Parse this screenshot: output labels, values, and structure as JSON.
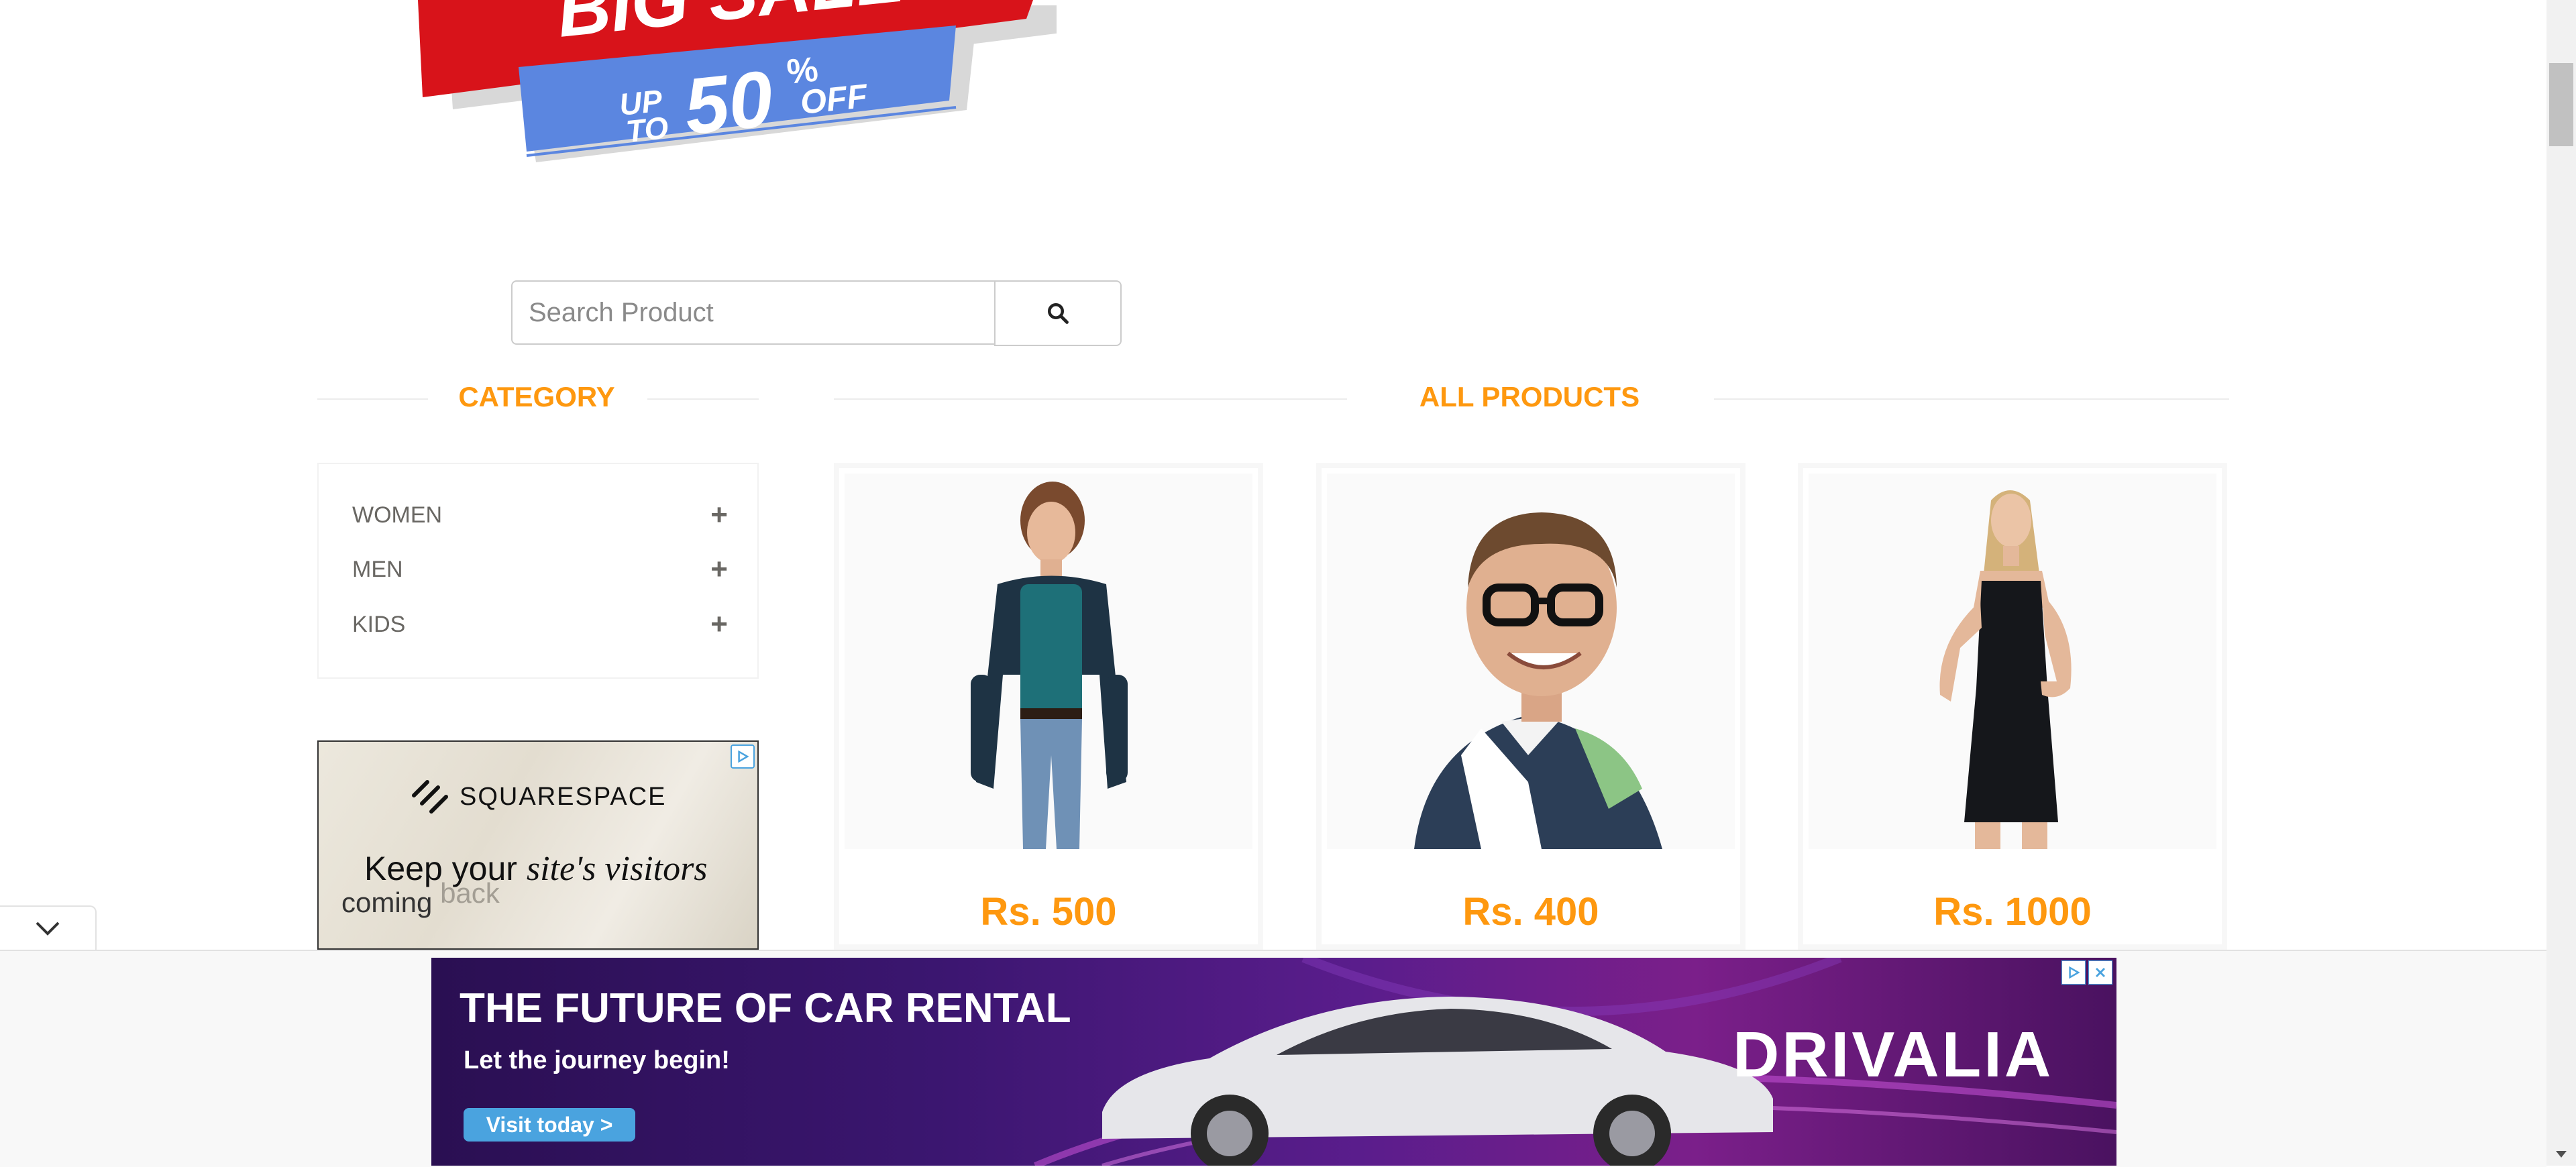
{
  "logo": {
    "line1": "BIG SALE",
    "up": "UP",
    "to": "TO",
    "percent": "50",
    "pct_sign": "%",
    "off": "OFF"
  },
  "search": {
    "placeholder": "Search Product",
    "value": ""
  },
  "category": {
    "heading": "CATEGORY",
    "items": [
      {
        "label": "WOMEN",
        "expand": "+"
      },
      {
        "label": "MEN",
        "expand": "+"
      },
      {
        "label": "KIDS",
        "expand": "+"
      }
    ]
  },
  "side_ad": {
    "brand": "SQUARESPACE",
    "headline_plain": "Keep your",
    "headline_italic": "site's visitors",
    "line2_a": "coming",
    "line2_b": "back"
  },
  "products": {
    "heading": "ALL PRODUCTS",
    "items": [
      {
        "price": "Rs. 500",
        "image": "woman-casual-photo"
      },
      {
        "price": "Rs. 400",
        "image": "man-glasses-photo"
      },
      {
        "price": "Rs. 1000",
        "image": "woman-black-dress-photo"
      }
    ]
  },
  "bottom_ad": {
    "headline": "THE FUTURE OF CAR RENTAL",
    "subline": "Let the journey begin!",
    "cta": "Visit today >",
    "brand": "DRIVALIA"
  },
  "colors": {
    "accent": "#fe980f",
    "text_gray": "#696763",
    "sale_red": "#d8131a",
    "sale_blue": "#5b86e0"
  }
}
